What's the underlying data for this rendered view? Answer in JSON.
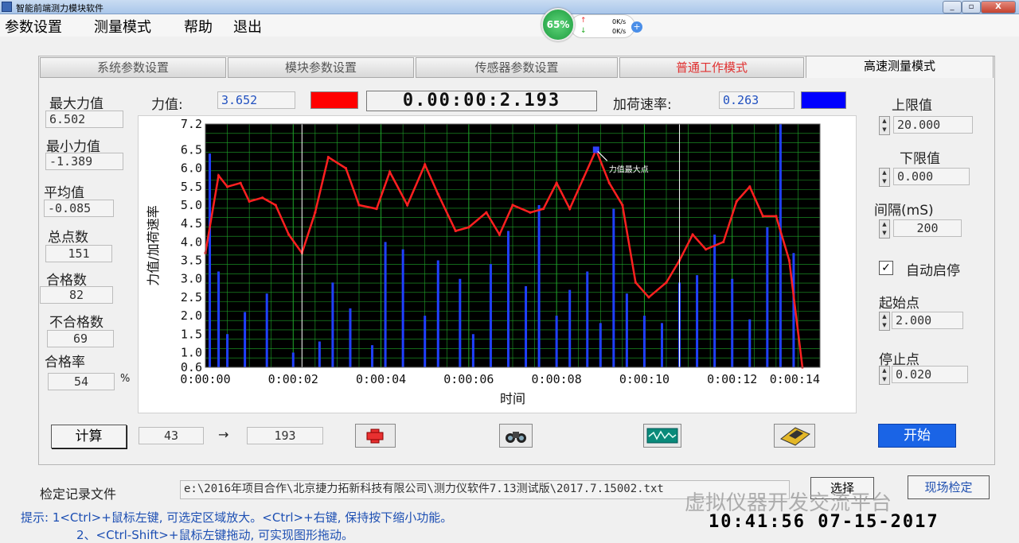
{
  "window": {
    "title": "智能前端测力模块软件",
    "btn_min": "_",
    "btn_max": "▫",
    "btn_close": "X"
  },
  "menu": {
    "items": [
      "参数设置",
      "测量模式",
      "帮助",
      "退出"
    ]
  },
  "speed_widget": {
    "percent": "65%",
    "up": "0K/s",
    "down": "0K/s"
  },
  "tabs": [
    "系统参数设置",
    "模块参数设置",
    "传感器参数设置",
    "普通工作模式",
    "高速测量模式"
  ],
  "stats": {
    "max_label": "最大力值",
    "max_value": "6.502",
    "min_label": "最小力值",
    "min_value": "-1.389",
    "avg_label": "平均值",
    "avg_value": "-0.085",
    "total_label": "总点数",
    "total_value": "151",
    "pass_label": "合格数",
    "pass_value": "82",
    "fail_label": "不合格数",
    "fail_value": "69",
    "rate_label": "合格率",
    "rate_value": "54",
    "rate_unit": "%"
  },
  "top_readout": {
    "force_label": "力值:",
    "force_value": "3.652",
    "timer": "0.00:00:2.193",
    "rate_label": "加荷速率:",
    "rate_value": "0.263",
    "force_color": "#ff0000",
    "rate_color": "#0000ff"
  },
  "right_panel": {
    "upper_label": "上限值",
    "upper_value": "20.000",
    "lower_label": "下限值",
    "lower_value": "0.000",
    "interval_label": "间隔(mS)",
    "interval_value": "200",
    "auto_label": "自动启停",
    "auto_checked": "✓",
    "start_label": "起始点",
    "start_value": "2.000",
    "stop_label": "停止点",
    "stop_value": "0.020"
  },
  "bottom_bar": {
    "calc_label": "计算",
    "from_value": "43",
    "arrow": "→",
    "to_value": "193",
    "start_button": "开始"
  },
  "file_row": {
    "label": "检定记录文件",
    "path": "e:\\2016年项目合作\\北京捷力拓新科技有限公司\\测力仪软件7.13测试版\\2017.7.15002.txt",
    "select_button": "选择",
    "verify_button": "现场检定"
  },
  "hints": [
    "提示: 1<Ctrl>+鼠标左键, 可选定区域放大。<Ctrl>+右键, 保持按下缩小功能。",
    "2、<Ctrl-Shift>+鼠标左键拖动, 可实现图形拖动。"
  ],
  "clock": "10:41:56 07-15-2017",
  "watermark": "虚拟仪器开发交流平台",
  "chart_data": {
    "type": "line",
    "ylabel": "力值/加荷速率",
    "xlabel": "时间",
    "x_tick_labels": [
      "0:00:00",
      "0:00:02",
      "0:00:04",
      "0:00:06",
      "0:00:08",
      "0:00:10",
      "0:00:12",
      "0:00:14"
    ],
    "y_tick_labels": [
      "7.2",
      "6.5",
      "6.0",
      "5.5",
      "5.0",
      "4.5",
      "4.0",
      "3.5",
      "3.0",
      "2.5",
      "2.0",
      "1.5",
      "1.0",
      "0.6"
    ],
    "xlim": [
      0,
      14
    ],
    "ylim": [
      0.6,
      7.2
    ],
    "grid": true,
    "background": "#000000",
    "grid_color": "#1fa52a",
    "cursor_x": [
      2.2,
      10.8
    ],
    "annotation": {
      "text": "力值最大点",
      "x": 8.9,
      "y": 6.502
    },
    "series": [
      {
        "color": "#ff2020",
        "x": [
          0,
          0.3,
          0.5,
          0.8,
          1.0,
          1.3,
          1.6,
          1.9,
          2.2,
          2.5,
          2.8,
          3.2,
          3.5,
          3.9,
          4.2,
          4.6,
          5.0,
          5.3,
          5.7,
          6.0,
          6.4,
          6.7,
          7.0,
          7.4,
          7.7,
          8.0,
          8.3,
          8.6,
          8.9,
          9.2,
          9.5,
          9.8,
          10.1,
          10.5,
          10.8,
          11.1,
          11.4,
          11.8,
          12.1,
          12.4,
          12.7,
          13.0,
          13.3,
          13.6
        ],
        "y": [
          3.7,
          5.8,
          5.5,
          5.6,
          5.1,
          5.2,
          5.0,
          4.2,
          3.7,
          4.8,
          6.3,
          6.0,
          5.0,
          4.9,
          5.9,
          5.0,
          6.1,
          5.3,
          4.3,
          4.4,
          4.8,
          4.2,
          5.0,
          4.8,
          4.9,
          5.6,
          4.9,
          5.7,
          6.5,
          5.6,
          5.0,
          2.9,
          2.5,
          2.9,
          3.5,
          4.2,
          3.8,
          4.0,
          5.1,
          5.5,
          4.7,
          4.7,
          3.5,
          0.6
        ]
      },
      {
        "color": "#2040ff",
        "x": [
          0.1,
          0.3,
          0.5,
          0.9,
          1.4,
          2.0,
          2.6,
          2.9,
          3.3,
          3.8,
          4.1,
          4.5,
          5.0,
          5.3,
          5.8,
          6.1,
          6.5,
          6.9,
          7.3,
          7.6,
          8.0,
          8.3,
          8.7,
          9.0,
          9.3,
          9.6,
          10.0,
          10.4,
          10.8,
          11.2,
          11.6,
          12.0,
          12.4,
          12.8,
          13.1,
          13.4
        ],
        "y": [
          6.4,
          3.2,
          1.5,
          2.1,
          2.6,
          1.0,
          1.3,
          2.9,
          2.2,
          1.2,
          4.0,
          3.8,
          2.0,
          3.5,
          3.0,
          1.5,
          3.4,
          4.3,
          2.8,
          5.0,
          2.0,
          2.7,
          3.2,
          1.8,
          4.9,
          2.6,
          2.0,
          1.8,
          2.9,
          3.1,
          4.2,
          3.0,
          1.9,
          4.4,
          7.2,
          3.7
        ]
      }
    ]
  }
}
